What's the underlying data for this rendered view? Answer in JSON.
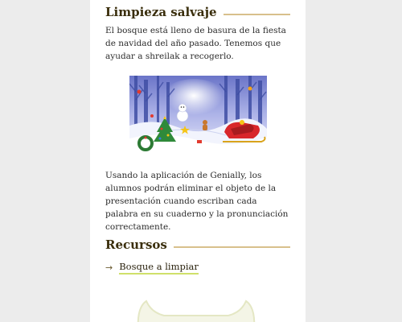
{
  "section1": {
    "title": "Limpieza salvaje",
    "intro": "El bosque está lleno de basura de la fiesta de navidad del año pasado. Tenemos que ayudar a shreilak a recogerlo.",
    "body": "Usando la aplicación de Genially, los alumnos podrán eliminar el objeto de la presentación cuando escriban cada palabra en su cuaderno y la pronunciación correctamente."
  },
  "section2": {
    "title": "Recursos",
    "link_label": "Bosque a limpiar"
  },
  "colors": {
    "page_bg": "#ececec",
    "heading": "#3a2e0c",
    "rule": "#d8c08c",
    "link_underline": "#cfe06a"
  }
}
